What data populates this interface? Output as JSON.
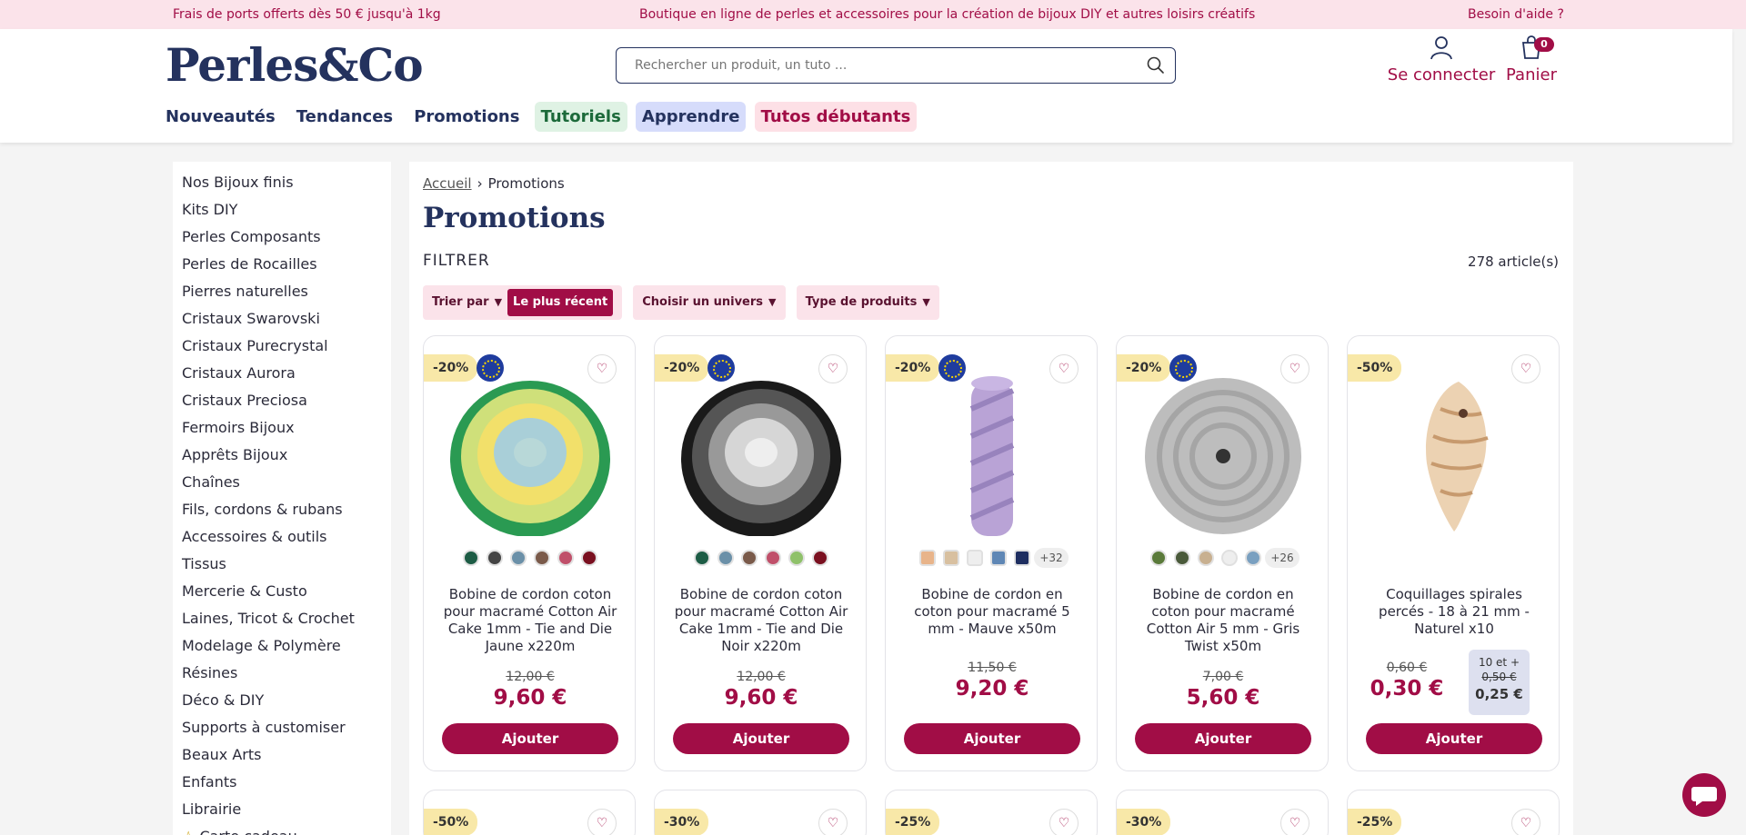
{
  "topbar": {
    "left": "Frais de ports offerts dès 50 € jusqu'à 1kg",
    "center": "Boutique en ligne de perles et accessoires pour la création de bijoux DIY et autres loisirs créatifs",
    "right": "Besoin d'aide ?"
  },
  "header": {
    "logo": "Perles&Co",
    "search_placeholder": "Rechercher un produit, un tuto ...",
    "login": "Se connecter",
    "cart": "Panier",
    "cart_count": "0"
  },
  "nav": [
    "Nouveautés",
    "Tendances",
    "Promotions",
    "Tutoriels",
    "Apprendre",
    "Tutos débutants"
  ],
  "sidebar": [
    "Nos Bijoux finis",
    "Kits DIY",
    "Perles Composants",
    "Perles de Rocailles",
    "Pierres naturelles",
    "Cristaux Swarovski",
    "Cristaux Purecrystal",
    "Cristaux Aurora",
    "Cristaux Preciosa",
    "Fermoirs Bijoux",
    "Apprêts Bijoux",
    "Chaînes",
    "Fils, cordons & rubans",
    "Accessoires & outils",
    "Tissus",
    "Mercerie & Custo",
    "Laines, Tricot & Crochet",
    "Modelage & Polymère",
    "Résines",
    "Déco & DIY",
    "Supports à customiser",
    "Beaux Arts",
    "Enfants",
    "Librairie",
    "Carte cadeau"
  ],
  "main": {
    "breadcrumb_home": "Accueil",
    "breadcrumb_current": "Promotions",
    "title": "Promotions",
    "filter_label": "FILTRER",
    "count": "278 article(s)",
    "sort_label": "Trier par",
    "sort_value": "Le plus récent",
    "universe": "Choisir un univers",
    "product_type": "Type de produits"
  },
  "colors": {
    "brand": "#a10d46",
    "navy": "#24325e"
  },
  "products": [
    {
      "discount": "-20%",
      "name": "Bobine de cordon coton pour macramé Cotton Air Cake 1mm - Tie and Die Jaune x220m",
      "old_price": "12,00 €",
      "price": "9,60 €",
      "button": "Ajouter",
      "swatches": [
        "#1d5c45",
        "#444444",
        "#6b90a8",
        "#7a5a4a",
        "#c0506a",
        "#7a1020"
      ]
    },
    {
      "discount": "-20%",
      "name": "Bobine de cordon coton pour macramé Cotton Air Cake 1mm - Tie and Die Noir x220m",
      "old_price": "12,00 €",
      "price": "9,60 €",
      "button": "Ajouter",
      "swatches": [
        "#1d5c45",
        "#6b90a8",
        "#7a5a4a",
        "#c0506a",
        "#8fc16a",
        "#7a1020"
      ]
    },
    {
      "discount": "-20%",
      "name": "Bobine de cordon en coton pour macramé 5 mm - Mauve x50m",
      "old_price": "11,50 €",
      "price": "9,20 €",
      "button": "Ajouter",
      "swatches": [
        "#e8b48a",
        "#d8c0a0",
        "#eeeeee",
        "#5f87b5",
        "#1e2e60"
      ],
      "more": "+32"
    },
    {
      "discount": "-20%",
      "name": "Bobine de cordon en coton pour macramé Cotton Air 5 mm - Gris Twist x50m",
      "old_price": "7,00 €",
      "price": "5,60 €",
      "button": "Ajouter",
      "swatches": [
        "#5a7a3a",
        "#4a5a3a",
        "#c8b090",
        "#eeeeee",
        "#7aa0c0"
      ],
      "more": "+26"
    },
    {
      "discount": "-50%",
      "name": "Coquillages spirales percés - 18 à 21 mm - Naturel x10",
      "old_price": "0,60 €",
      "price": "0,30 €",
      "button": "Ajouter",
      "tier_label": "10 et +",
      "tier_old": "0,50 €",
      "tier_new": "0,25 €"
    }
  ],
  "row2_discounts": [
    "-50%",
    "-30%",
    "-25%",
    "-30%",
    "-25%"
  ]
}
